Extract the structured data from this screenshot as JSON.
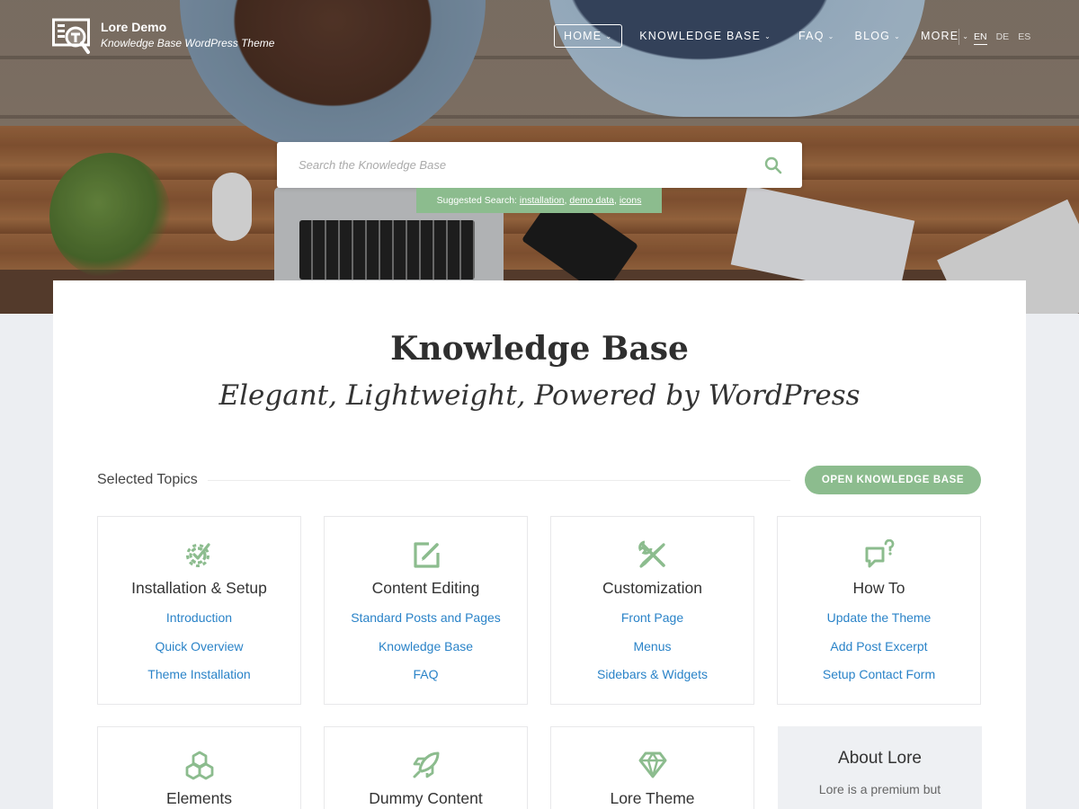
{
  "header": {
    "site_title": "Lore Demo",
    "site_tagline": "Knowledge Base WordPress Theme",
    "nav": [
      {
        "label": "HOME",
        "active": true
      },
      {
        "label": "KNOWLEDGE BASE",
        "active": false
      },
      {
        "label": "FAQ",
        "active": false
      },
      {
        "label": "BLOG",
        "active": false
      },
      {
        "label": "MORE",
        "active": false
      }
    ],
    "languages": [
      "EN",
      "DE",
      "ES"
    ],
    "active_language": "EN"
  },
  "search": {
    "placeholder": "Search the Knowledge Base",
    "suggest_prefix": "Suggested Search:",
    "suggestions": [
      "installation",
      "demo data",
      "icons"
    ]
  },
  "main": {
    "title": "Knowledge Base",
    "subtitle": "Elegant, Lightweight, Powered by WordPress",
    "selected_label": "Selected Topics",
    "open_button": "OPEN KNOWLEDGE BASE",
    "topics": [
      {
        "title": "Installation & Setup",
        "icon": "gear-check-icon",
        "links": [
          "Introduction",
          "Quick Overview",
          "Theme Installation"
        ]
      },
      {
        "title": "Content Editing",
        "icon": "edit-icon",
        "links": [
          "Standard Posts and Pages",
          "Knowledge Base",
          "FAQ"
        ]
      },
      {
        "title": "Customization",
        "icon": "tools-icon",
        "links": [
          "Front Page",
          "Menus",
          "Sidebars & Widgets"
        ]
      },
      {
        "title": "How To",
        "icon": "chat-question-icon",
        "links": [
          "Update the Theme",
          "Add Post Excerpt",
          "Setup Contact Form"
        ]
      },
      {
        "title": "Elements",
        "icon": "cubes-icon",
        "links": []
      },
      {
        "title": "Dummy Content",
        "icon": "rocket-icon",
        "links": []
      },
      {
        "title": "Lore Theme",
        "icon": "diamond-icon",
        "links": []
      }
    ],
    "about": {
      "title": "About Lore",
      "text": "Lore is a premium but"
    }
  },
  "colors": {
    "accent": "#8cbc8e",
    "link": "#2a83c8",
    "page_bg": "#eceef2"
  }
}
